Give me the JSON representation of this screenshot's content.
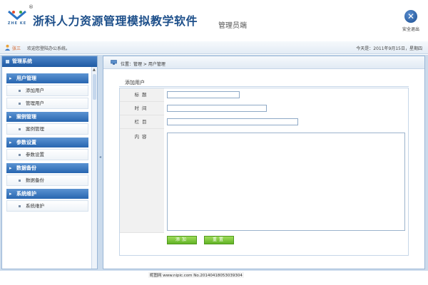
{
  "header": {
    "logo_sub": "ZHE KE",
    "logo_reg": "®",
    "app_title": "浙科人力资源管理模拟教学软件",
    "role": "管理员端",
    "logout_label": "安全退出",
    "logout_glyph": "✕"
  },
  "welcome": {
    "name": "张三",
    "text": "欢迎您登陆办公系统。",
    "date": "今天是：2011年9月15日，星期四"
  },
  "sidebar": {
    "title": "管理系统",
    "groups": [
      {
        "title": "用户管理",
        "items": [
          "添加用户",
          "管理用户"
        ]
      },
      {
        "title": "案例管理",
        "items": [
          "案例管理"
        ]
      },
      {
        "title": "参数设置",
        "items": [
          "参数设置"
        ]
      },
      {
        "title": "数据备份",
        "items": [
          "数据备份"
        ]
      },
      {
        "title": "系统维护",
        "items": [
          "系统维护"
        ]
      }
    ]
  },
  "main": {
    "breadcrumb": "位置：管理 > 用户管理",
    "form_title": "添加用户",
    "labels": {
      "title": "标题",
      "time": "时间",
      "column": "栏目",
      "content": "内容"
    },
    "fields": {
      "title_value": "",
      "time_value": "",
      "column_value": ""
    },
    "buttons": {
      "add": "添加",
      "reset": "重置"
    }
  },
  "watermark": "昵图网 www.nipic.com  No.20140418053039304",
  "colors": {
    "brand_blue": "#1d4f8a",
    "accent_green": "#62b326",
    "highlight_orange": "#d25a1c"
  }
}
